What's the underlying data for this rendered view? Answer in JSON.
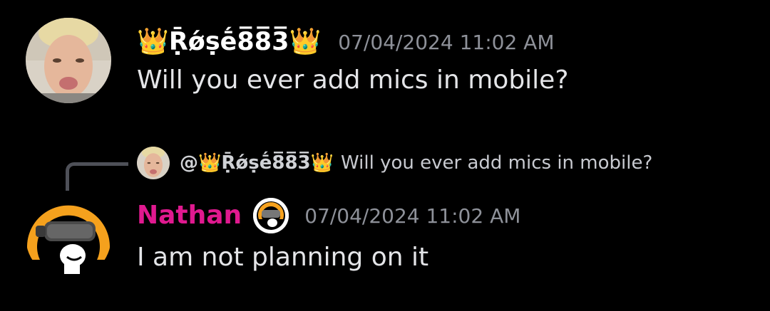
{
  "messages": [
    {
      "author": {
        "prefix_emoji": "👑",
        "name": "Ṝǿṣḗ8̅8̅3̅",
        "suffix_emoji": "👑"
      },
      "timestamp": "07/04/2024 11:02 AM",
      "content": "Will you ever add mics in mobile?"
    },
    {
      "reply_to": {
        "mention_prefix": "@",
        "prefix_emoji": "👑",
        "name": "Ṝǿṣḗ8̅8̅3̅",
        "suffix_emoji": "👑",
        "preview": "Will you ever add mics in mobile?"
      },
      "author": {
        "name": "Nathan",
        "name_color": "#e0198f"
      },
      "timestamp": "07/04/2024 11:02 AM",
      "content": "I am not planning on it"
    }
  ],
  "colors": {
    "background": "#000000",
    "timestamp": "#8e9199",
    "reply_spine": "#4e5058",
    "nathan_avatar_ring": "#f5a11d"
  },
  "icons": {
    "rose_avatar": "user-photo-avatar",
    "nathan_avatar": "vr-headset-character-avatar",
    "nathan_badge": "vr-headset-badge-icon"
  }
}
